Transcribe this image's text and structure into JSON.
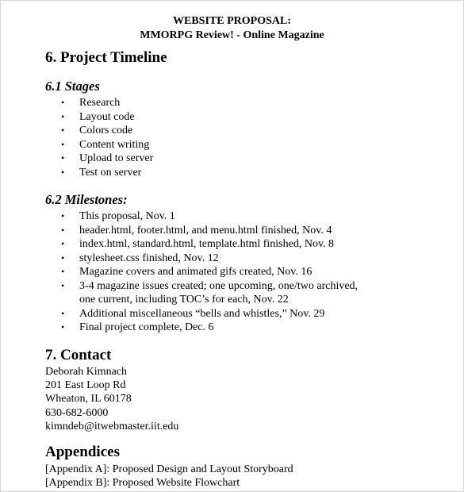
{
  "header": {
    "line1": "WEBSITE PROPOSAL:",
    "line2": "MMORPG Review! - Online Magazine"
  },
  "timeline": {
    "title": "6. Project Timeline",
    "stages": {
      "title": "6.1 Stages",
      "items": [
        "Research",
        "Layout code",
        "Colors code",
        "Content writing",
        "Upload to server",
        "Test on server"
      ]
    },
    "milestones": {
      "title": "6.2 Milestones:",
      "items": [
        [
          "This proposal, Nov. 1"
        ],
        [
          "header.html, footer.html, and menu.html finished, Nov. 4"
        ],
        [
          "index.html, standard.html, template.html finished, Nov. 8"
        ],
        [
          "stylesheet.css finished, Nov. 12"
        ],
        [
          "Magazine covers and animated gifs created, Nov. 16"
        ],
        [
          "3-4 magazine issues created; one upcoming, one/two archived,",
          "one current, including TOC’s for each, Nov. 22"
        ],
        [
          "Additional miscellaneous “bells and whistles,” Nov. 29"
        ],
        [
          "Final project complete, Dec. 6"
        ]
      ]
    }
  },
  "contact": {
    "title": "7. Contact",
    "lines": [
      "Deborah Kimnach",
      "201 East Loop Rd",
      "Wheaton, IL 60178",
      "630-682-6000",
      "kimndeb@itwebmaster.iit.edu"
    ]
  },
  "appendices": {
    "title": "Appendices",
    "lines": [
      "[Appendix A]: Proposed Design and Layout Storyboard",
      "[Appendix B]: Proposed Website Flowchart"
    ]
  },
  "icons": {
    "bullet": "•"
  }
}
